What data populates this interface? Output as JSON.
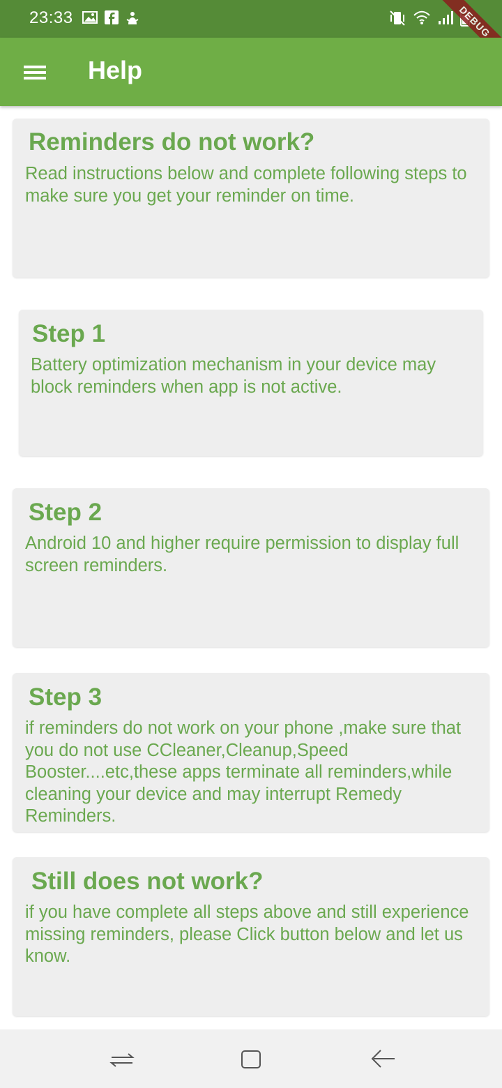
{
  "status_bar": {
    "time": "23:33",
    "debug_label": "DEBUG",
    "left_icons": [
      "image-icon",
      "facebook-icon",
      "notification-icon"
    ],
    "right_icons": [
      "vibrate-mute-icon",
      "wifi-icon",
      "signal-icon",
      "battery-icon"
    ]
  },
  "app_bar": {
    "title": "Help",
    "menu_icon": "menu-icon"
  },
  "cards": [
    {
      "title": "Reminders do not work?",
      "body": "Read instructions below and complete following steps to make sure you get your reminder on time."
    },
    {
      "title": "Step 1",
      "body": "Battery optimization mechanism in your device may block reminders when app is not active."
    },
    {
      "title": "Step 2",
      "body": "Android 10 and higher require permission to display  full screen reminders."
    },
    {
      "title": "Step 3",
      "body": "if reminders do not work on your phone ,make sure that you do not use CCleaner,Cleanup,Speed Booster....etc,these apps terminate all reminders,while cleaning your device and may interrupt Remedy Reminders."
    },
    {
      "title": "Still does not work?",
      "body": "if you have complete all steps above and still experience missing reminders, please Click button below and let us know."
    }
  ],
  "nav_bar": {
    "icons": [
      "recent-apps-icon",
      "home-icon",
      "back-icon"
    ]
  },
  "colors": {
    "status_bar": "#558b37",
    "app_bar": "#6fae46",
    "card_background": "#eeeeee",
    "card_text": "#6aa84f",
    "nav_bar": "#f1f1f1"
  }
}
